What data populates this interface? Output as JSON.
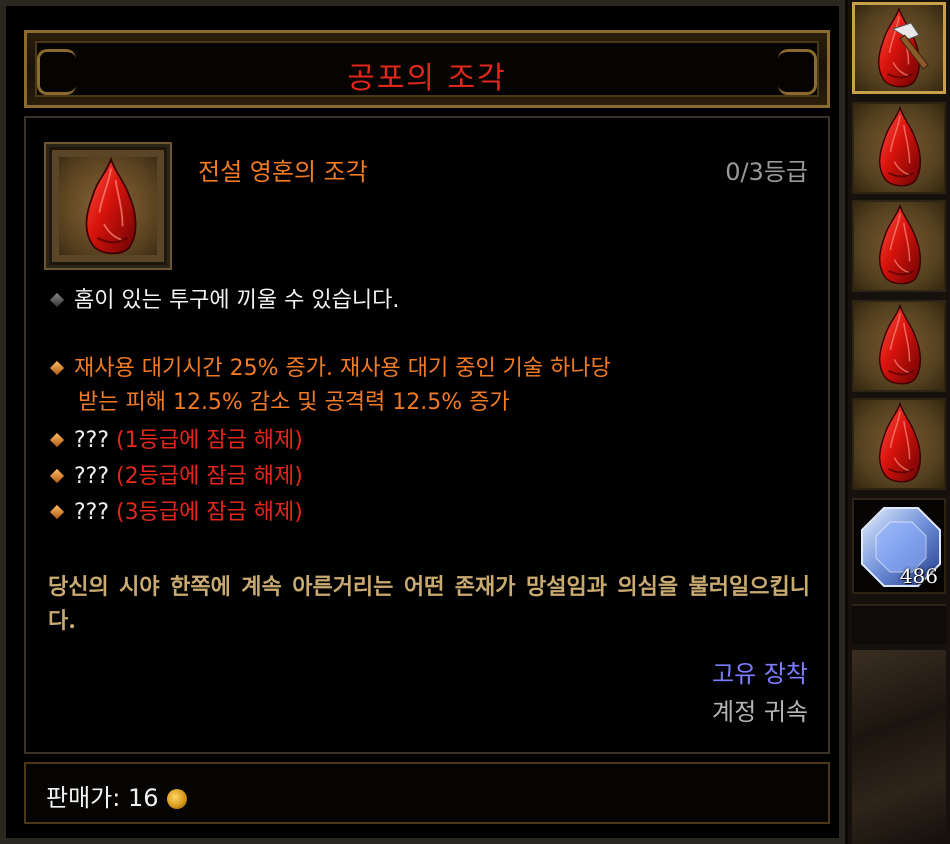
{
  "item": {
    "title": "공포의 조각",
    "subtitle": "전설 영혼의 조각",
    "rank": "0/3등급",
    "socket_text": "홈이 있는 투구에 끼울 수 있습니다.",
    "effect_line1": "재사용 대기시간 25% 증가. 재사용 대기 중인 기술 하나당",
    "effect_line2": "받는 피해 12.5% 감소 및 공격력 12.5% 증가",
    "locked": [
      {
        "prefix": "???",
        "text": "(1등급에 잠금 해제)"
      },
      {
        "prefix": "???",
        "text": "(2등급에 잠금 해제)"
      },
      {
        "prefix": "???",
        "text": "(3등급에 잠금 해제)"
      }
    ],
    "flavor": "당신의 시야 한쪽에 계속 아른거리는 어떤 존재가 망설임과 의심을 불러일으킵니다.",
    "unique_equip": "고유 장착",
    "account_bound": "계정 귀속",
    "sell_price_label": "판매가: 16"
  },
  "side": {
    "gem_count": "486"
  },
  "icons": {
    "item_icon": "red-shard-icon",
    "gold": "gold-coin-icon",
    "gem": "diamond-gem-icon",
    "salvage": "hammer-icon"
  },
  "colors": {
    "title": "#e2271a",
    "legendary": "#f07b24",
    "flavor": "#c9aa71",
    "unique": "#7d7dff",
    "bound": "#b4b4b4"
  }
}
